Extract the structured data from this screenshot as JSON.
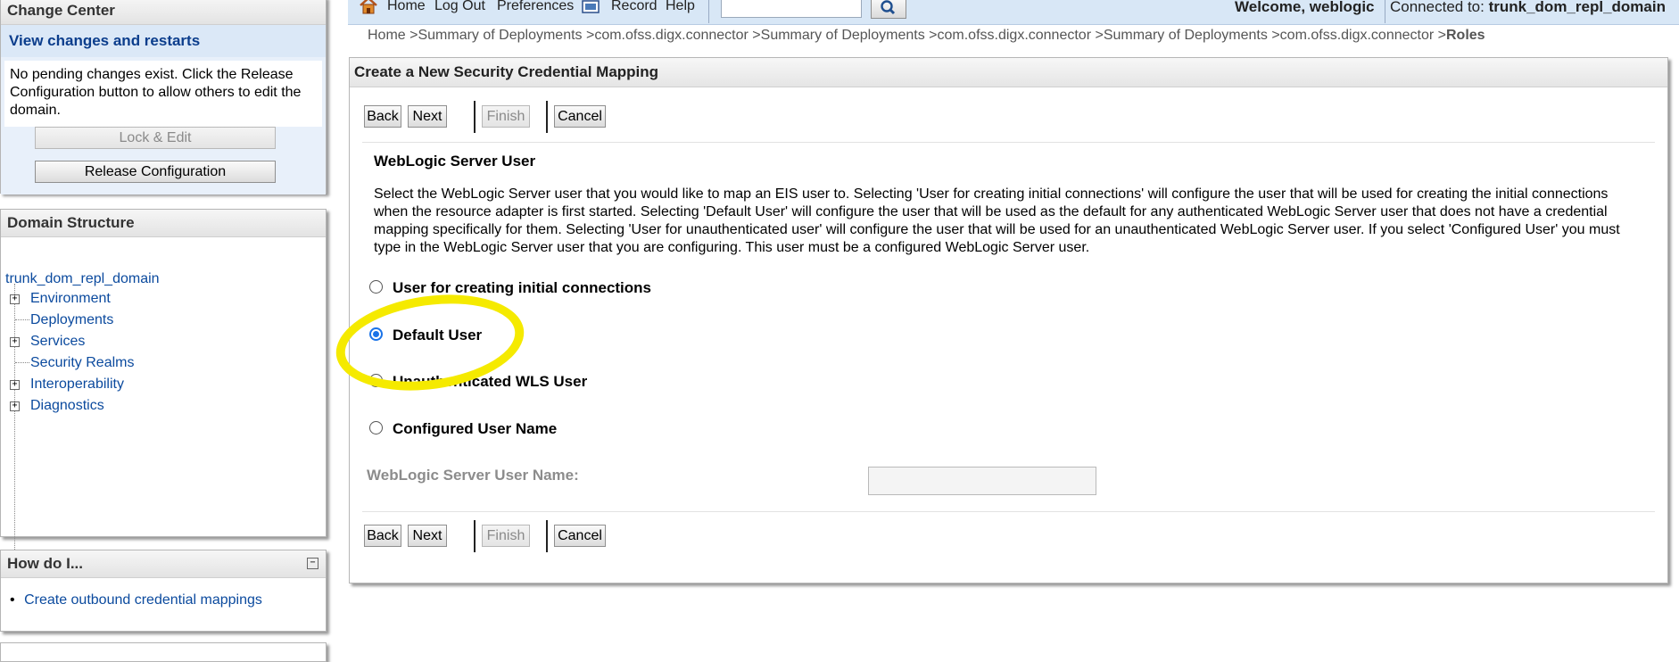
{
  "change_center": {
    "title": "Change Center",
    "subtitle": "View changes and restarts",
    "message": "No pending changes exist. Click the Release Configuration button to allow others to edit the domain.",
    "lock_edit": "Lock & Edit",
    "release_config": "Release Configuration"
  },
  "domain_structure": {
    "title": "Domain Structure",
    "root": "trunk_dom_repl_domain",
    "items": [
      {
        "label": "Environment",
        "expandable": true
      },
      {
        "label": "Deployments",
        "expandable": false
      },
      {
        "label": "Services",
        "expandable": true
      },
      {
        "label": "Security Realms",
        "expandable": false
      },
      {
        "label": "Interoperability",
        "expandable": true
      },
      {
        "label": "Diagnostics",
        "expandable": true
      }
    ]
  },
  "how_do_i": {
    "title": "How do I...",
    "items": [
      "Create outbound credential mappings"
    ]
  },
  "topbar": {
    "home": "Home",
    "logout": "Log Out",
    "preferences": "Preferences",
    "record": "Record",
    "help": "Help",
    "search_value": "",
    "welcome": "Welcome, weblogic",
    "connected_label": "Connected to:",
    "connected_domain": "trunk_dom_repl_domain"
  },
  "breadcrumb": {
    "items": [
      "Home >",
      "Summary of Deployments >",
      "com.ofss.digx.connector >",
      "Summary of Deployments >",
      "com.ofss.digx.connector >",
      "Summary of Deployments >",
      "com.ofss.digx.connector >"
    ],
    "current": "Roles"
  },
  "main": {
    "title": "Create a New Security Credential Mapping",
    "buttons": {
      "back": "Back",
      "next": "Next",
      "finish": "Finish",
      "cancel": "Cancel"
    },
    "section_title": "WebLogic Server User",
    "description": "Select the WebLogic Server user that you would like to map an EIS user to. Selecting 'User for creating initial connections' will configure the user that will be used for creating the initial connections when the resource adapter is first started. Selecting 'Default User' will configure the user that will be used as the default for any authenticated WebLogic Server user that does not have a credential mapping specifically for them. Selecting 'User for unauthenticated user' will configure the user that will be used for an unauthenticated WebLogic Server user. If you select 'Configured User' you must type in the WebLogic Server user that you are configuring. This user must be a configured WebLogic Server user.",
    "options": [
      {
        "label": "User for creating initial connections",
        "checked": false
      },
      {
        "label": "Default User",
        "checked": true
      },
      {
        "label": "Unauthenticated WLS User",
        "checked": false
      },
      {
        "label": "Configured User Name",
        "checked": false
      }
    ],
    "user_name_label": "WebLogic Server User Name:",
    "user_name_value": ""
  },
  "colors": {
    "link": "#0b4a9e",
    "topbar_bg": "#d8e7f6",
    "highlight": "#f5ea00",
    "radio_selected": "#1a73e8"
  }
}
